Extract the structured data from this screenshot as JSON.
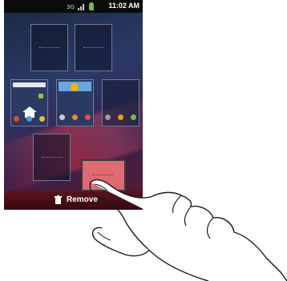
{
  "status_bar": {
    "time": "11:02 AM",
    "icons": [
      "network-3g-icon",
      "signal-icon",
      "battery-icon"
    ]
  },
  "home_screen_panels": {
    "rows": [
      {
        "panels": [
          "empty",
          "empty"
        ]
      },
      {
        "panels": [
          "home-with-search-bar",
          "weather-widget",
          "shortcuts"
        ]
      },
      {
        "panels": [
          "empty"
        ]
      }
    ],
    "dragged_panel": "highlighted-for-removal"
  },
  "remove_bar": {
    "label": "Remove",
    "icon": "trash-icon",
    "color": "#5a1420"
  },
  "gesture": {
    "icon": "hand-pointer-icon",
    "action": "drag"
  }
}
